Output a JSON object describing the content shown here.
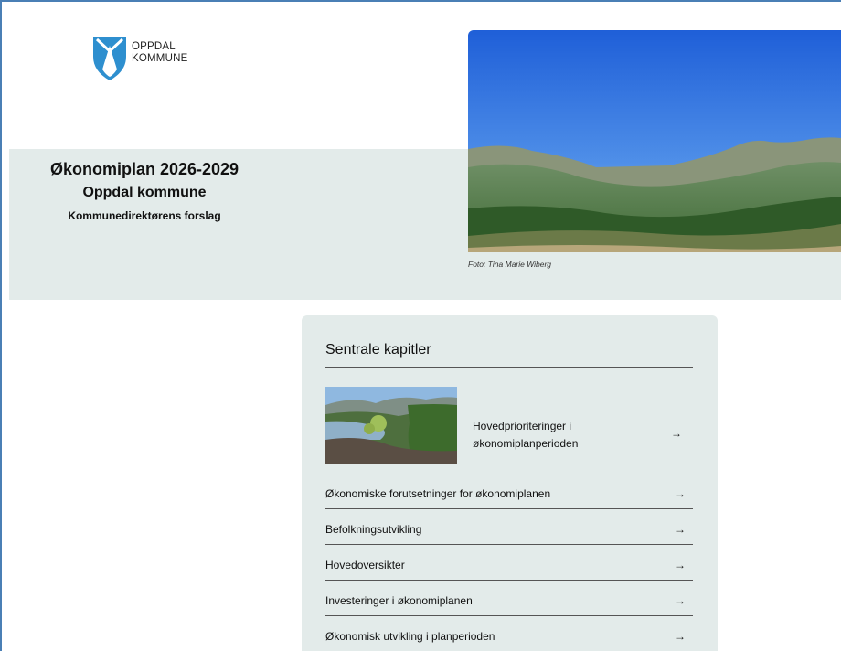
{
  "logo": {
    "line1": "OPPDAL",
    "line2": "KOMMUNE"
  },
  "hero": {
    "title": "Økonomiplan 2026-2029",
    "subtitle": "Oppdal kommune",
    "tagline": "Kommunedirektørens forslag",
    "photo_credit": "Foto: Tina Marie Wiberg"
  },
  "chapters": {
    "heading": "Sentrale kapitler",
    "arrow": "→",
    "feature": {
      "label": "Hovedprioriteringer i økonomiplanperioden"
    },
    "items": [
      {
        "label": "Økonomiske forutsetninger for økonomiplanen"
      },
      {
        "label": "Befolkningsutvikling"
      },
      {
        "label": "Hovedoversikter"
      },
      {
        "label": "Investeringer i økonomiplanen"
      },
      {
        "label": "Økonomisk utvikling i planperioden"
      }
    ]
  },
  "colors": {
    "band": "#e3ebea",
    "logo_blue": "#2e8fcf",
    "border": "#4a7fb5"
  }
}
